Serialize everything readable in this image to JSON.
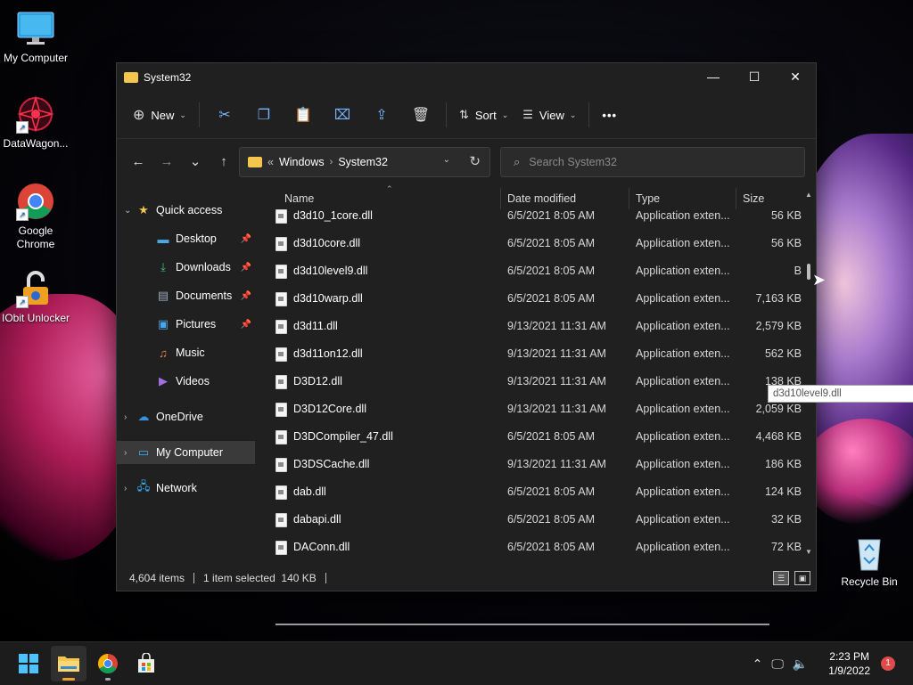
{
  "desktop": {
    "icons": [
      {
        "label": "My Computer"
      },
      {
        "label": "DataWagon..."
      },
      {
        "label": "Google Chrome"
      },
      {
        "label": "IObit Unlocker"
      },
      {
        "label": "Recycle Bin"
      }
    ]
  },
  "window": {
    "title": "System32",
    "controls": {
      "minimize": "—",
      "maximize": "☐",
      "close": "✕"
    }
  },
  "toolbar": {
    "new_label": "New",
    "sort_label": "Sort",
    "view_label": "View",
    "more_label": "•••",
    "icons": [
      "cut-icon",
      "copy-icon",
      "paste-icon",
      "rename-icon",
      "share-icon",
      "delete-icon"
    ]
  },
  "navigation": {
    "back": "←",
    "forward": "→",
    "recent": "⌄",
    "up": "↑"
  },
  "address": {
    "overflow": "«",
    "crumbs": [
      "Windows",
      "System32"
    ],
    "separator": "›"
  },
  "search": {
    "placeholder": "Search System32"
  },
  "sidebar": {
    "items": [
      {
        "label": "Quick access",
        "icon": "star-icon"
      },
      {
        "label": "Desktop",
        "icon": "desktop-icon",
        "pinned": true
      },
      {
        "label": "Downloads",
        "icon": "download-icon",
        "pinned": true
      },
      {
        "label": "Documents",
        "icon": "documents-icon",
        "pinned": true
      },
      {
        "label": "Pictures",
        "icon": "pictures-icon",
        "pinned": true
      },
      {
        "label": "Music",
        "icon": "music-icon"
      },
      {
        "label": "Videos",
        "icon": "videos-icon"
      },
      {
        "label": "OneDrive",
        "icon": "onedrive-icon"
      },
      {
        "label": "My Computer",
        "icon": "computer-icon",
        "selected": true
      },
      {
        "label": "Network",
        "icon": "network-icon"
      }
    ]
  },
  "columns": {
    "name": "Name",
    "date": "Date modified",
    "type": "Type",
    "size": "Size"
  },
  "files": [
    {
      "name": "d3d10_1core.dll",
      "date": "6/5/2021 8:05 AM",
      "type": "Application exten...",
      "size": "56 KB"
    },
    {
      "name": "d3d10core.dll",
      "date": "6/5/2021 8:05 AM",
      "type": "Application exten...",
      "size": "56 KB"
    },
    {
      "name": "d3d10level9.dll",
      "date": "6/5/2021 8:05 AM",
      "type": "Application exten...",
      "size": "B"
    },
    {
      "name": "d3d10warp.dll",
      "date": "6/5/2021 8:05 AM",
      "type": "Application exten...",
      "size": "7,163 KB"
    },
    {
      "name": "d3d11.dll",
      "date": "9/13/2021 11:31 AM",
      "type": "Application exten...",
      "size": "2,579 KB"
    },
    {
      "name": "d3d11on12.dll",
      "date": "9/13/2021 11:31 AM",
      "type": "Application exten...",
      "size": "562 KB"
    },
    {
      "name": "D3D12.dll",
      "date": "9/13/2021 11:31 AM",
      "type": "Application exten...",
      "size": "138 KB"
    },
    {
      "name": "D3D12Core.dll",
      "date": "9/13/2021 11:31 AM",
      "type": "Application exten...",
      "size": "2,059 KB"
    },
    {
      "name": "D3DCompiler_47.dll",
      "date": "6/5/2021 8:05 AM",
      "type": "Application exten...",
      "size": "4,468 KB"
    },
    {
      "name": "D3DSCache.dll",
      "date": "9/13/2021 11:31 AM",
      "type": "Application exten...",
      "size": "186 KB"
    },
    {
      "name": "dab.dll",
      "date": "6/5/2021 8:05 AM",
      "type": "Application exten...",
      "size": "124 KB"
    },
    {
      "name": "dabapi.dll",
      "date": "6/5/2021 8:05 AM",
      "type": "Application exten...",
      "size": "32 KB"
    },
    {
      "name": "DAConn.dll",
      "date": "6/5/2021 8:05 AM",
      "type": "Application exten...",
      "size": "72 KB"
    }
  ],
  "tooltip": "d3d10level9.dll",
  "status": {
    "item_count": "4,604 items",
    "selection": "1 item selected  140 KB"
  },
  "taskbar": {
    "apps": [
      "start-icon",
      "file-explorer-icon",
      "chrome-icon",
      "store-icon"
    ],
    "time": "2:23 PM",
    "date": "1/9/2022",
    "notifications": "1"
  },
  "colors": {
    "accent": "#7ab3ff",
    "folder": "#f5c64d",
    "window_bg": "#202020",
    "taskbar_bg": "#1c1c1c"
  }
}
